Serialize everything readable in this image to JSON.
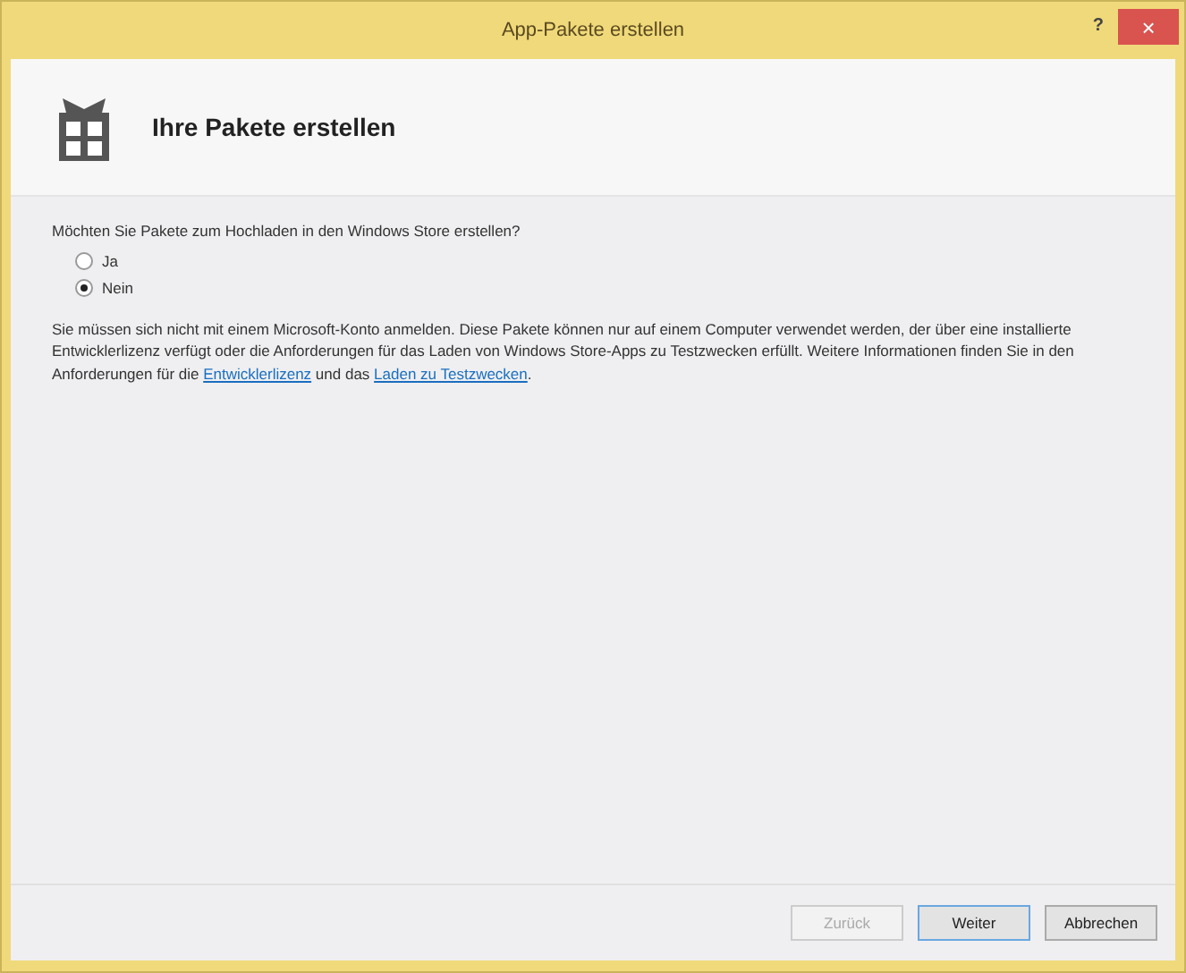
{
  "window": {
    "title": "App-Pakete erstellen",
    "help": "?",
    "close": "×"
  },
  "header": {
    "title": "Ihre Pakete erstellen"
  },
  "question": "Möchten Sie Pakete zum Hochladen in den Windows Store erstellen?",
  "options": [
    {
      "label": "Ja",
      "selected": false
    },
    {
      "label": "Nein",
      "selected": true
    }
  ],
  "description": [
    {
      "kind": "text",
      "text": "Sie müssen sich nicht mit einem Microsoft-Konto anmelden. Diese Pakete können nur auf einem Computer verwendet werden, der über eine installierte Entwicklerlizenz verfügt oder die Anforderungen für das Laden von Windows Store-Apps zu Testzwecken erfüllt. Weitere Informationen finden Sie in den Anforderungen für die "
    },
    {
      "kind": "link",
      "text": "Entwicklerlizenz"
    },
    {
      "kind": "text",
      "text": " und das "
    },
    {
      "kind": "link",
      "text": "Laden zu Testzwecken"
    },
    {
      "kind": "text",
      "text": "."
    }
  ],
  "buttons": [
    {
      "label": "Zurück",
      "disabled": true,
      "default": false
    },
    {
      "label": "Weiter",
      "disabled": false,
      "default": true
    },
    {
      "label": "Abbrechen",
      "disabled": false,
      "default": false
    }
  ]
}
